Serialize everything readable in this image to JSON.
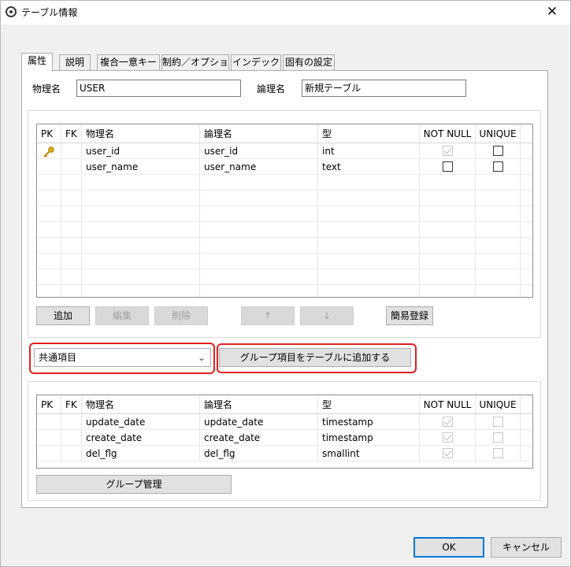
{
  "window": {
    "title": "テーブル情報",
    "close_glyph": "✕"
  },
  "tabs": [
    "属性",
    "説明",
    "複合一意キー",
    "制約／オプション",
    "インデックス",
    "固有の設定"
  ],
  "form": {
    "physical_label": "物理名",
    "physical_value": "USER",
    "logical_label": "論理名",
    "logical_value": "新規テーブル"
  },
  "columns_header": [
    "PK",
    "FK",
    "物理名",
    "論理名",
    "型",
    "NOT NULL",
    "UNIQUE"
  ],
  "columns": [
    {
      "physical": "user_id",
      "logical": "user_id",
      "type": "int",
      "pk_icon": "key-icon"
    },
    {
      "physical": "user_name",
      "logical": "user_name",
      "type": "text"
    }
  ],
  "buttons": {
    "add": "追加",
    "edit": "編集",
    "delete": "削除",
    "up": "↑",
    "down": "↓",
    "quick": "簡易登録"
  },
  "group": {
    "select_value": "共通項目",
    "add_button": "グループ項目をテーブルに追加する",
    "manage_button": "グループ管理",
    "rows": [
      {
        "physical": "update_date",
        "logical": "update_date",
        "type": "timestamp"
      },
      {
        "physical": "create_date",
        "logical": "create_date",
        "type": "timestamp"
      },
      {
        "physical": "del_flg",
        "logical": "del_flg",
        "type": "smallint"
      }
    ]
  },
  "footer": {
    "ok": "OK",
    "cancel": "キャンセル"
  },
  "colors": {
    "highlight": "#e02020",
    "ok_border": "#0078d7"
  }
}
